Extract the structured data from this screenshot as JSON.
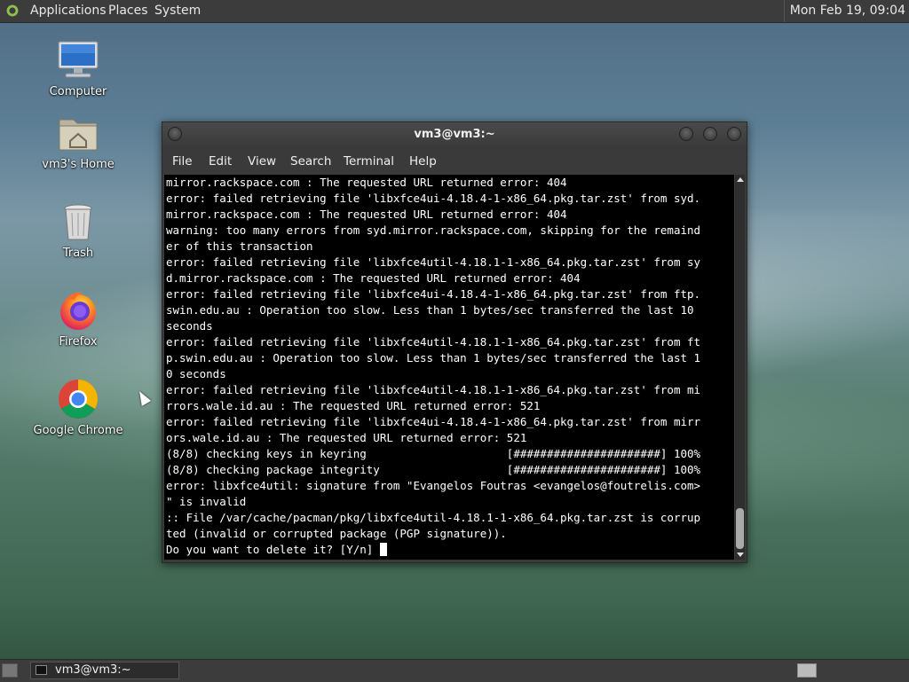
{
  "top_panel": {
    "menus": [
      "Applications",
      "Places",
      "System"
    ],
    "clock": "Mon Feb 19, 09:04"
  },
  "desktop_icons": [
    {
      "label": "Computer",
      "icon": "computer-icon"
    },
    {
      "label": "vm3's Home",
      "icon": "home-folder-icon"
    },
    {
      "label": "Trash",
      "icon": "trash-icon"
    },
    {
      "label": "Firefox",
      "icon": "firefox-icon"
    },
    {
      "label": "Google Chrome",
      "icon": "chrome-icon"
    }
  ],
  "terminal": {
    "title": "vm3@vm3:~",
    "menus": [
      "File",
      "Edit",
      "View",
      "Search",
      "Terminal",
      "Help"
    ],
    "lines": [
      "mirror.rackspace.com : The requested URL returned error: 404",
      "error: failed retrieving file 'libxfce4ui-4.18.4-1-x86_64.pkg.tar.zst' from syd.",
      "mirror.rackspace.com : The requested URL returned error: 404",
      "warning: too many errors from syd.mirror.rackspace.com, skipping for the remaind",
      "er of this transaction",
      "error: failed retrieving file 'libxfce4util-4.18.1-1-x86_64.pkg.tar.zst' from sy",
      "d.mirror.rackspace.com : The requested URL returned error: 404",
      "error: failed retrieving file 'libxfce4ui-4.18.4-1-x86_64.pkg.tar.zst' from ftp.",
      "swin.edu.au : Operation too slow. Less than 1 bytes/sec transferred the last 10",
      "seconds",
      "error: failed retrieving file 'libxfce4util-4.18.1-1-x86_64.pkg.tar.zst' from ft",
      "p.swin.edu.au : Operation too slow. Less than 1 bytes/sec transferred the last 1",
      "0 seconds",
      "error: failed retrieving file 'libxfce4util-4.18.1-1-x86_64.pkg.tar.zst' from mi",
      "rrors.wale.id.au : The requested URL returned error: 521",
      "error: failed retrieving file 'libxfce4ui-4.18.4-1-x86_64.pkg.tar.zst' from mirr",
      "ors.wale.id.au : The requested URL returned error: 521",
      "(8/8) checking keys in keyring                     [######################] 100%",
      "(8/8) checking package integrity                   [######################] 100%",
      "error: libxfce4util: signature from \"Evangelos Foutras <evangelos@foutrelis.com>",
      "\" is invalid",
      ":: File /var/cache/pacman/pkg/libxfce4util-4.18.1-1-x86_64.pkg.tar.zst is corrup",
      "ted (invalid or corrupted package (PGP signature)).",
      "Do you want to delete it? [Y/n] "
    ]
  },
  "bottom_panel": {
    "task_label": "vm3@vm3:~"
  }
}
